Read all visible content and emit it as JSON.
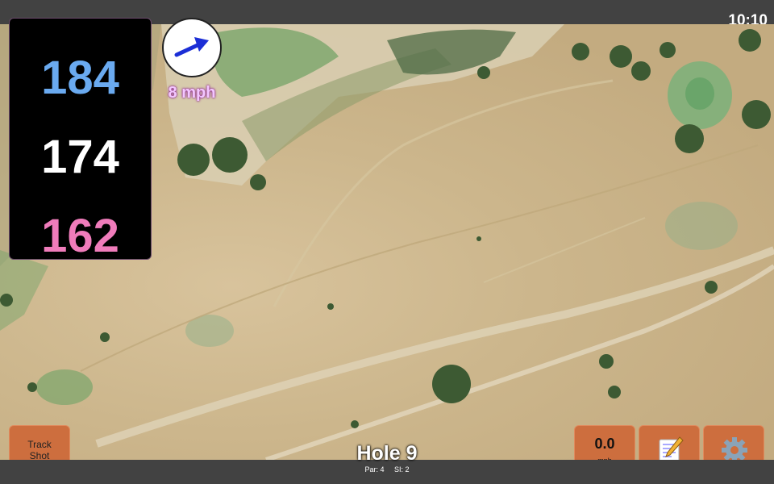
{
  "status": {
    "time": "10:10"
  },
  "distances": {
    "back": "184",
    "middle": "174",
    "front": "162"
  },
  "wind": {
    "speed_label": "8 mph",
    "direction_icon": "arrow-icon"
  },
  "buttons": {
    "track_shot_line1": "Track",
    "track_shot_line2": "Shot",
    "wind_value": "0.0",
    "wind_unit": "mph",
    "notes_icon": "memo-icon",
    "settings_icon": "gear-icon"
  },
  "hole": {
    "title": "Hole 9",
    "par": "Par: 4",
    "si": "SI: 2"
  },
  "colors": {
    "back": "#6aaaf0",
    "middle": "#ffffff",
    "front": "#f07cbb",
    "button": "#cd6e3e",
    "bar": "#424242"
  }
}
